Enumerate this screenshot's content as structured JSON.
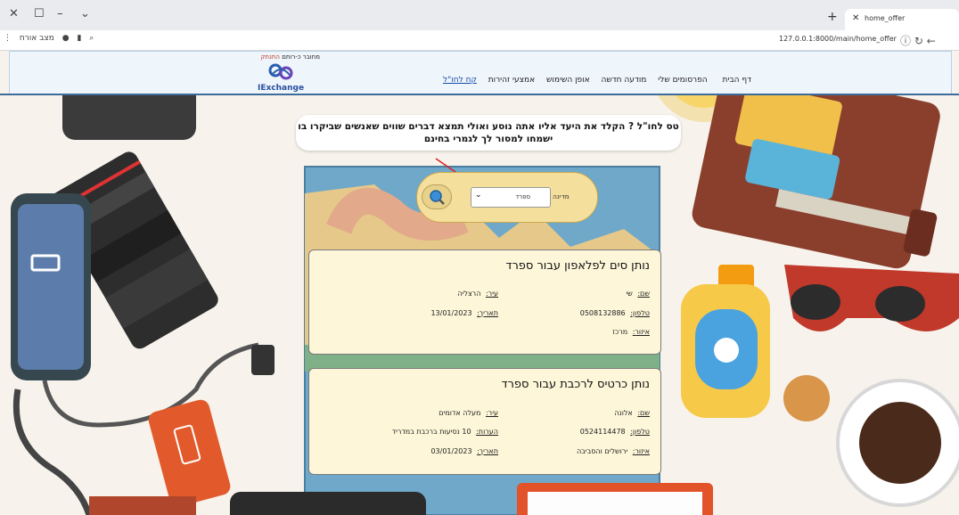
{
  "browser": {
    "tab_title": "home_offer",
    "url": "127.0.0.1:8000/main/home_offer",
    "guest_label": "מצב אורח"
  },
  "header": {
    "user_prefix": "מחובר כ-",
    "user_name": "רותם",
    "logout": "התנתק",
    "logo_text": "IExchange",
    "nav": [
      "דף הבית",
      "הפרסומים שלי",
      "מודעה חדשה",
      "אופן השימוש",
      "אמצעי זהירות",
      "קח לחו\"ל"
    ]
  },
  "headline": "טס לחו\"ל ? הקלד את היעד אליו אתה נוסע ואולי תמצא דברים שווים שאנשים שביקרו בו ישמחו למסור  לך לגמרי בחינם",
  "search": {
    "city_label": "מדינה",
    "selected_value": "ספרד"
  },
  "labels": {
    "name": "שם:",
    "city": "עיר:",
    "phone": "טלפון:",
    "date": "תאריך:",
    "area": "איזור:",
    "notes": "הערות:"
  },
  "cards": [
    {
      "title": "נותן סים לפלאפון עבור ספרד",
      "name": "שי",
      "city": "הרצליה",
      "phone": "0508132886",
      "date": "13/01/2023",
      "area": "מרכז"
    },
    {
      "title": "נותן כרטיס לרכבת עבור ספרד",
      "name": "אלונה",
      "city": "מעלה אדומים",
      "phone": "0524114478",
      "notes": "10 נסיעות ברכבת במדריד",
      "area": "ירושלים והסביבה",
      "date": "03/01/2023"
    }
  ]
}
